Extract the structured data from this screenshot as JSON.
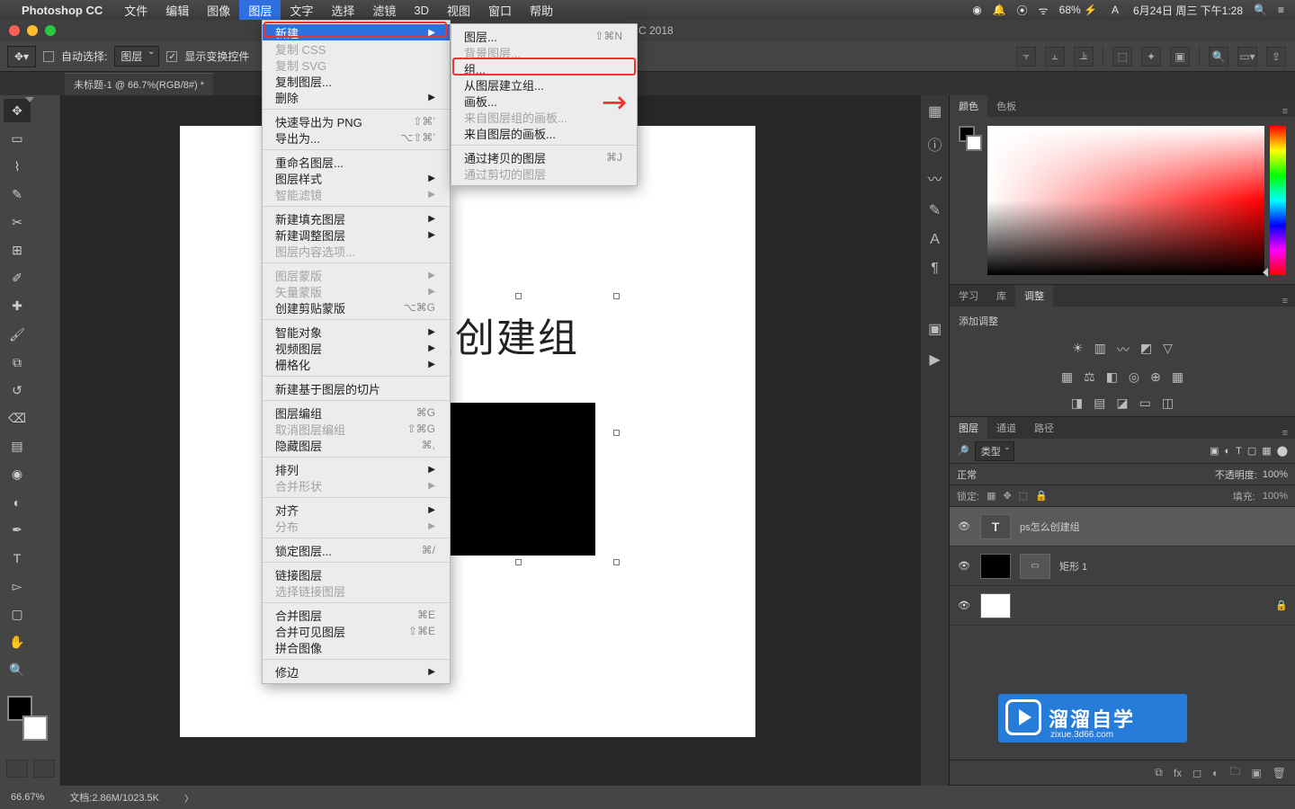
{
  "menubar": {
    "app": "Photoshop CC",
    "items": [
      "文件",
      "编辑",
      "图像",
      "图层",
      "文字",
      "选择",
      "滤镜",
      "3D",
      "视图",
      "窗口",
      "帮助"
    ],
    "active_index": 3,
    "status": {
      "battery": "68%",
      "battery_icon": "⚡",
      "date": "6月24日 周三 下午1:28",
      "input": "A"
    }
  },
  "titlebar": {
    "title": "p CC 2018"
  },
  "options": {
    "auto_select": "自动选择:",
    "target": "图层",
    "show_transform": "显示变换控件"
  },
  "doc_tab": "未标题-1 @ 66.7%(RGB/8#) *",
  "canvas": {
    "text": "么创建组"
  },
  "right": {
    "color_tabs": [
      "颜色",
      "色板"
    ],
    "adjust_tabs": [
      "学习",
      "库",
      "调整"
    ],
    "adjust_title": "添加调整",
    "layer_tabs": [
      "图层",
      "通道",
      "路径"
    ],
    "filter": "类型",
    "blend": {
      "mode": "正常",
      "opacity_label": "不透明度:",
      "opacity": "100%"
    },
    "lock": {
      "label": "锁定:",
      "fill_label": "填充:",
      "fill": "100%"
    },
    "layers": [
      {
        "name": "ps怎么创建组",
        "type": "text"
      },
      {
        "name": "矩形 1",
        "type": "rect"
      },
      {
        "name": "",
        "type": "bg"
      }
    ]
  },
  "statusbar": {
    "zoom": "66.67%",
    "doc": "文档:2.86M/1023.5K"
  },
  "menu_layer": [
    {
      "t": "新建",
      "arrow": true,
      "hl": true
    },
    {
      "t": "复制 CSS",
      "dis": true
    },
    {
      "t": "复制 SVG",
      "dis": true
    },
    {
      "t": "复制图层..."
    },
    {
      "t": "删除",
      "arrow": true
    },
    {
      "sep": true
    },
    {
      "t": "快速导出为 PNG",
      "sc": "⇧⌘’"
    },
    {
      "t": "导出为...",
      "sc": "⌥⇧⌘’"
    },
    {
      "sep": true
    },
    {
      "t": "重命名图层..."
    },
    {
      "t": "图层样式",
      "arrow": true
    },
    {
      "t": "智能滤镜",
      "dis": true,
      "arrow": true
    },
    {
      "sep": true
    },
    {
      "t": "新建填充图层",
      "arrow": true
    },
    {
      "t": "新建调整图层",
      "arrow": true
    },
    {
      "t": "图层内容选项...",
      "dis": true
    },
    {
      "sep": true
    },
    {
      "t": "图层蒙版",
      "dis": true,
      "arrow": true
    },
    {
      "t": "矢量蒙版",
      "dis": true,
      "arrow": true
    },
    {
      "t": "创建剪贴蒙版",
      "sc": "⌥⌘G"
    },
    {
      "sep": true
    },
    {
      "t": "智能对象",
      "arrow": true
    },
    {
      "t": "视频图层",
      "arrow": true
    },
    {
      "t": "栅格化",
      "arrow": true
    },
    {
      "sep": true
    },
    {
      "t": "新建基于图层的切片"
    },
    {
      "sep": true
    },
    {
      "t": "图层编组",
      "sc": "⌘G"
    },
    {
      "t": "取消图层编组",
      "dis": true,
      "sc": "⇧⌘G"
    },
    {
      "t": "隐藏图层",
      "sc": "⌘,"
    },
    {
      "sep": true
    },
    {
      "t": "排列",
      "arrow": true
    },
    {
      "t": "合并形状",
      "dis": true,
      "arrow": true
    },
    {
      "sep": true
    },
    {
      "t": "对齐",
      "arrow": true
    },
    {
      "t": "分布",
      "dis": true,
      "arrow": true
    },
    {
      "sep": true
    },
    {
      "t": "锁定图层...",
      "sc": "⌘/"
    },
    {
      "sep": true
    },
    {
      "t": "链接图层"
    },
    {
      "t": "选择链接图层",
      "dis": true
    },
    {
      "sep": true
    },
    {
      "t": "合并图层",
      "sc": "⌘E"
    },
    {
      "t": "合并可见图层",
      "sc": "⇧⌘E"
    },
    {
      "t": "拼合图像"
    },
    {
      "sep": true
    },
    {
      "t": "修边",
      "arrow": true
    }
  ],
  "menu_new": [
    {
      "t": "图层...",
      "sc": "⇧⌘N"
    },
    {
      "t": "背景图层...",
      "dis": true
    },
    {
      "t": "组..."
    },
    {
      "t": "从图层建立组..."
    },
    {
      "t": "画板..."
    },
    {
      "t": "来自图层组的画板...",
      "dis": true
    },
    {
      "t": "来自图层的画板..."
    },
    {
      "sep": true
    },
    {
      "t": "通过拷贝的图层",
      "sc": "⌘J"
    },
    {
      "t": "通过剪切的图层",
      "dis": true
    }
  ],
  "watermark": {
    "brand": "溜溜自学",
    "url": "zixue.3d66.com"
  }
}
